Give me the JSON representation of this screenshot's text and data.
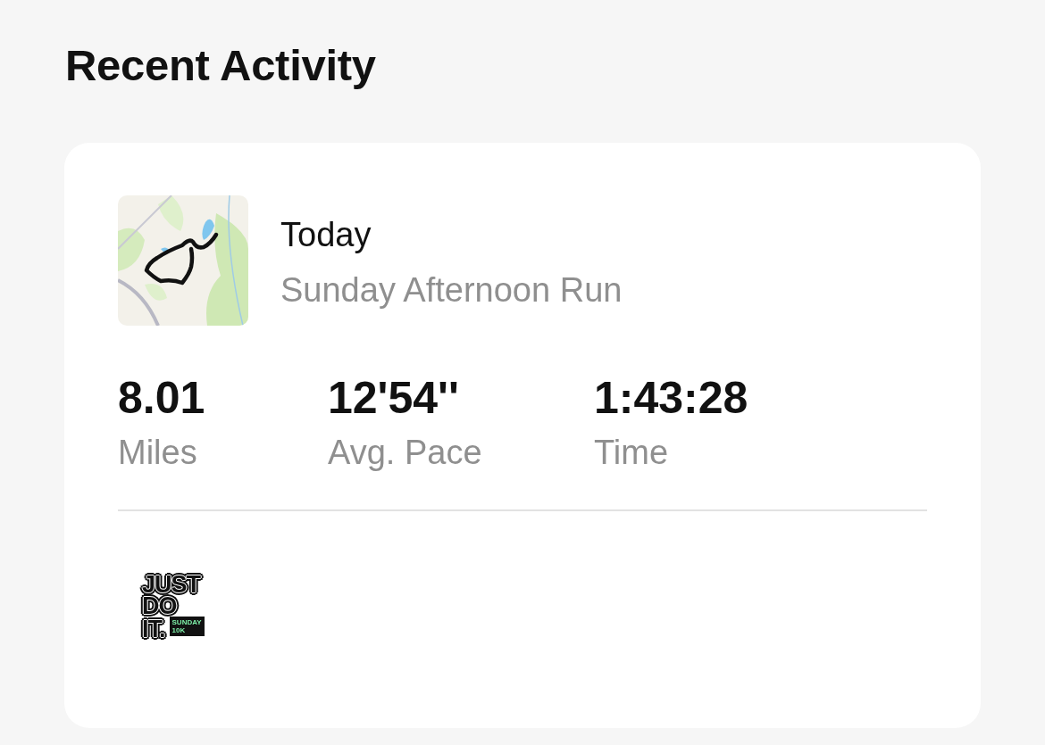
{
  "page": {
    "title": "Recent Activity"
  },
  "activity": {
    "date": "Today",
    "name": "Sunday Afternoon Run",
    "stats": [
      {
        "value": "8.01",
        "label": "Miles"
      },
      {
        "value": "12'54''",
        "label": "Avg. Pace"
      },
      {
        "value": "1:43:28",
        "label": "Time"
      }
    ],
    "badge": {
      "lines": [
        "JUST",
        "DO",
        "IT."
      ],
      "tag": [
        "SUNDAY",
        "10K"
      ]
    }
  }
}
